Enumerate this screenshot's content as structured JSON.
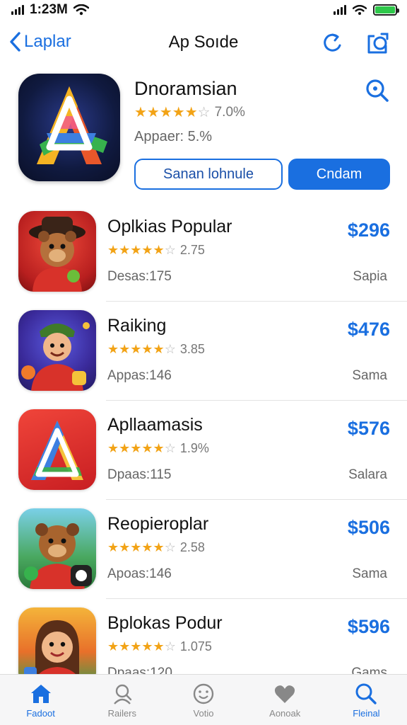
{
  "status": {
    "time": "1:23M"
  },
  "nav": {
    "back_label": "Laplar",
    "title": "Ap Soıde"
  },
  "featured": {
    "name": "Dnoramsian",
    "rating": 4.5,
    "rating_text": "7.0%",
    "subtitle": "Appaer: 5.%",
    "secondary_button": "Sanan lohnule",
    "primary_button": "Cndam"
  },
  "apps": [
    {
      "name": "Oplkias Popular",
      "rating_text": "2.75",
      "subtitle": "Desas:175",
      "price": "$296",
      "tag": "Sapia"
    },
    {
      "name": "Raiking",
      "rating_text": "3.85",
      "subtitle": "Appas:146",
      "price": "$476",
      "tag": "Sama"
    },
    {
      "name": "Apllaamasis",
      "rating_text": "1.9%",
      "subtitle": "Dpaas:115",
      "price": "$576",
      "tag": "Salara"
    },
    {
      "name": "Reopieroplar",
      "rating_text": "2.58",
      "subtitle": "Apoas:146",
      "price": "$506",
      "tag": "Sama"
    },
    {
      "name": "Bplokas Podur",
      "rating_text": "1.075",
      "subtitle": "Dpaas:120",
      "price": "$596",
      "tag": "Gams"
    }
  ],
  "tabs": [
    {
      "label": "Fadoot",
      "icon": "home-icon",
      "active": true
    },
    {
      "label": "Railers",
      "icon": "search-person-icon",
      "active": false
    },
    {
      "label": "Votio",
      "icon": "smiley-icon",
      "active": false
    },
    {
      "label": "Aonoak",
      "icon": "heart-icon",
      "active": false
    },
    {
      "label": "Fleinal",
      "icon": "search-icon",
      "active": true
    }
  ],
  "colors": {
    "accent": "#1a6fe0",
    "star": "#f2a316",
    "battery": "#2ec84a"
  }
}
